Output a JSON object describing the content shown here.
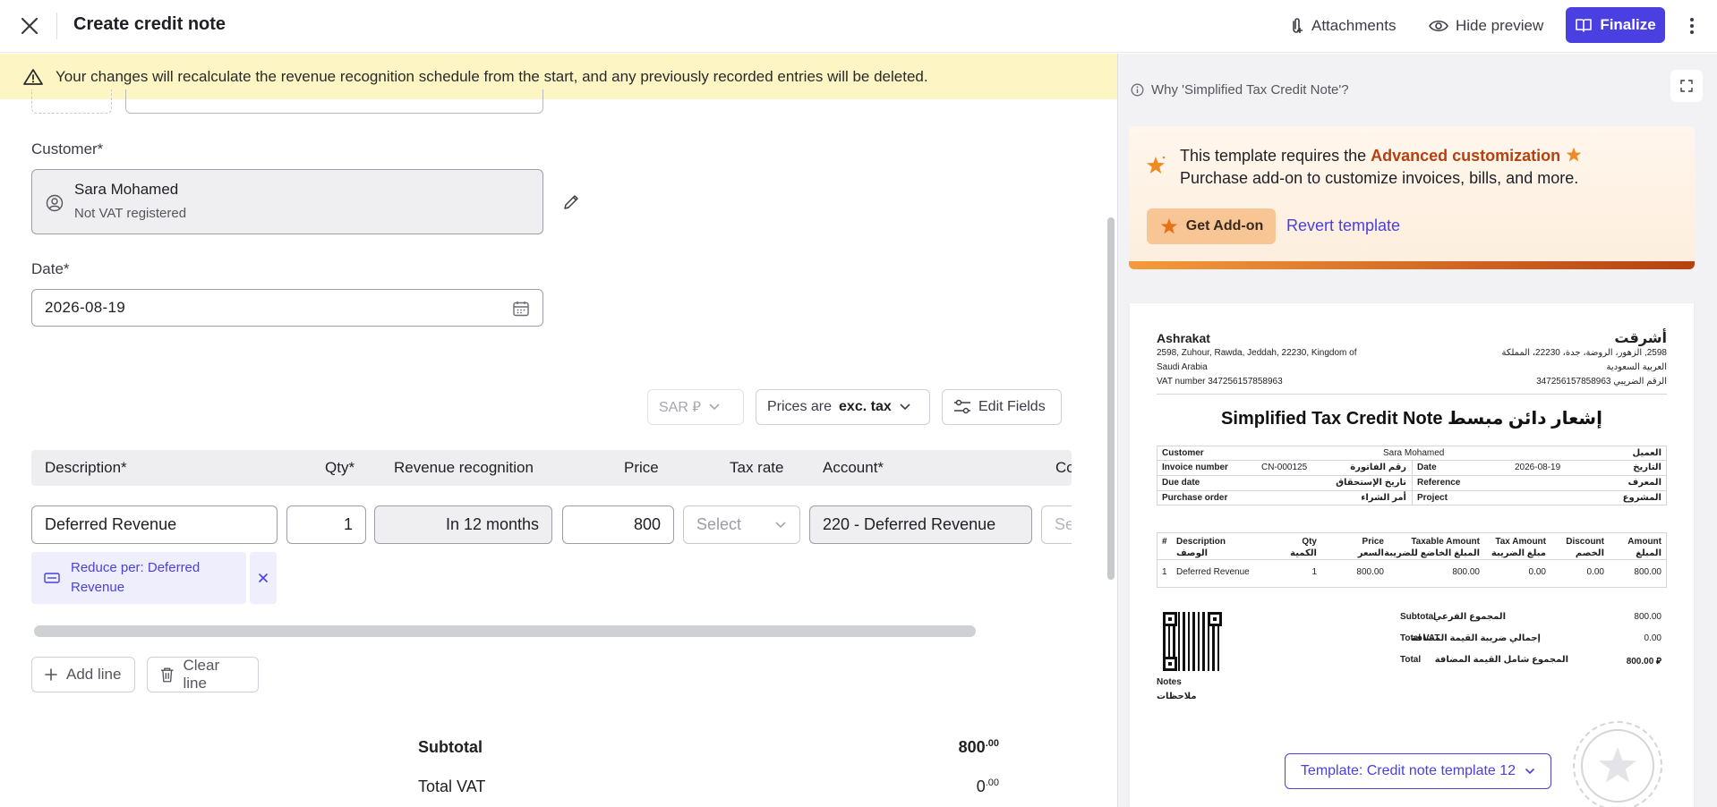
{
  "header": {
    "title": "Create credit note",
    "attachments": "Attachments",
    "hide_preview": "Hide preview",
    "finalize": "Finalize"
  },
  "banner": {
    "text": "Your changes will recalculate the revenue recognition schedule from the start, and any previously recorded entries will be deleted."
  },
  "form": {
    "customer_label": "Customer*",
    "customer_name": "Sara Mohamed",
    "customer_vat_status": "Not VAT registered",
    "date_label": "Date*",
    "date_value": "2026-08-19",
    "currency": "SAR ⃁",
    "prices_prefix": "Prices are",
    "prices_mode": "exc. tax",
    "edit_fields": "Edit Fields"
  },
  "line_grid": {
    "columns": [
      "Description*",
      "Qty*",
      "Revenue recognition",
      "Price",
      "Tax rate",
      "Account*",
      "Co"
    ],
    "row": {
      "description": "Deferred Revenue",
      "qty": "1",
      "revenue_recognition": "In 12 months",
      "price": "800",
      "tax_rate_placeholder": "Select",
      "account": "220 - Deferred Revenue",
      "cost_center_placeholder": "Se"
    },
    "reduce_tag": "Reduce per: Deferred Revenue",
    "add_line": "Add line",
    "clear_line": "Clear line"
  },
  "totals": {
    "subtotal_label": "Subtotal",
    "subtotal_int": "800",
    "subtotal_dec": ".00",
    "vat_label": "Total VAT",
    "vat_int": "0",
    "vat_dec": ".00"
  },
  "preview": {
    "why": "Why 'Simplified Tax Credit Note'?",
    "promo_line1_prefix": "This template requires the",
    "promo_link": "Advanced customization",
    "promo_line2": "Purchase add-on to customize invoices, bills, and more.",
    "get_addon": "Get Add-on",
    "revert": "Revert template",
    "template_button": "Template: Credit note template 12",
    "doc": {
      "company_en": "Ashrakat",
      "address_en_1": "2598, Zuhour, Rawda, Jeddah, 22230, Kingdom of",
      "address_en_2": "Saudi Arabia",
      "vat_en": "VAT number 347256157858963",
      "company_ar": "أشرقت",
      "address_ar_1": "2598, الزهور، الروضة، جدة، 22230، المملكة",
      "address_ar_2": "العربية السعودية",
      "vat_ar": "الرقم الضريبي 347256157858963",
      "title": "Simplified Tax Credit Note إشعار دائن مبسط",
      "info": {
        "customer_l": "Customer",
        "customer_v": "Sara Mohamed",
        "customer_ar": "العميل",
        "invoice_l": "Invoice number",
        "invoice_v": "CN-000125",
        "invoice_ar": "رقم الفاتورة",
        "date_l": "Date",
        "date_v": "2026-08-19",
        "date_ar": "التاريخ",
        "due_l": "Due date",
        "due_ar": "تاريخ الإستحقاق",
        "ref_l": "Reference",
        "ref_ar": "المعرف",
        "po_l": "Purchase order",
        "po_ar": "أمر الشراء",
        "project_l": "Project",
        "project_ar": "المشروع"
      },
      "items_head": {
        "num": "#",
        "desc": "Description",
        "desc_ar": "الوصف",
        "qty": "Qty",
        "qty_ar": "الكمية",
        "price": "Price",
        "price_ar": "السعر",
        "taxable": "Taxable Amount",
        "taxable_ar": "المبلغ الخاضع للضريبة",
        "tax": "Tax Amount",
        "tax_ar": "مبلغ الضريبة",
        "discount": "Discount",
        "discount_ar": "الخصم",
        "amount": "Amount",
        "amount_ar": "المبلغ"
      },
      "item": {
        "num": "1",
        "desc": "Deferred Revenue",
        "qty": "1",
        "price": "800.00",
        "taxable": "800.00",
        "tax": "0.00",
        "discount": "0.00",
        "amount": "800.00"
      },
      "sum": {
        "subtotal_l": "Subtotal",
        "subtotal_ar": "المجموع الفرعي",
        "subtotal_v": "800.00",
        "vat_l": "Total VAT",
        "vat_ar": "إجمالي ضريبة القيمة المضافة",
        "vat_v": "0.00",
        "total_l": "Total",
        "total_ar": "المجموع شامل القيمة المضافة",
        "total_v": "⃁ 800.00"
      },
      "notes": "Notes",
      "notes_ar": "ملاحظات"
    }
  },
  "colors": {
    "accent": "#4a3fe0",
    "warning_bg": "#fdf6c4",
    "promo_link": "#b6410f"
  }
}
